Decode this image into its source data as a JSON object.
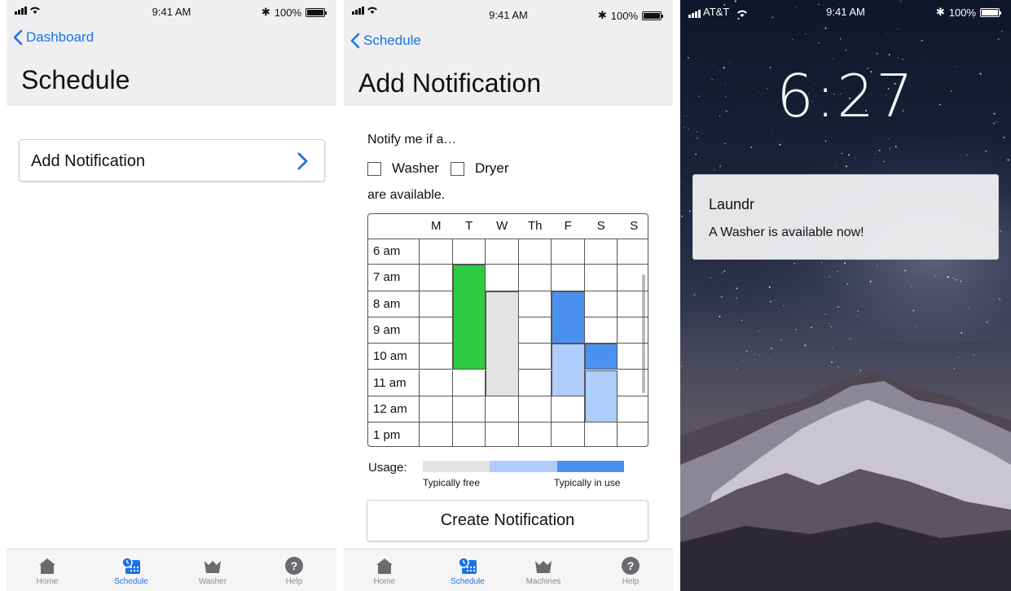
{
  "status": {
    "time": "9:41 AM",
    "battery": "100%",
    "carrier": "AT&T"
  },
  "tabs": {
    "home": "Home",
    "schedule": "Schedule",
    "washer": "Washer",
    "machines": "Machines",
    "help": "Help"
  },
  "screen1": {
    "back_label": "Dashboard",
    "title": "Schedule",
    "row_label": "Add Notification"
  },
  "screen2": {
    "back_label": "Schedule",
    "title": "Add Notification",
    "intro": "Notify me if a…",
    "options": [
      "Washer",
      "Dryer"
    ],
    "options_checked": [
      false,
      false
    ],
    "outro": "are available.",
    "days": [
      "M",
      "T",
      "W",
      "Th",
      "F",
      "S",
      "S"
    ],
    "times": [
      "6 am",
      "7 am",
      "8 am",
      "9 am",
      "10 am",
      "11 am",
      "12 am",
      "1 pm"
    ],
    "usage_label": "Usage:",
    "usage_low": "Typically free",
    "usage_high": "Typically in use",
    "create_label": "Create Notification",
    "blocks": [
      {
        "day": 1,
        "start": 1,
        "end": 5,
        "color": "#2ecc40"
      },
      {
        "day": 2,
        "start": 2,
        "end": 6,
        "color": "#e3e3e3"
      },
      {
        "day": 4,
        "start": 2,
        "end": 4,
        "color": "#4a90f0"
      },
      {
        "day": 4,
        "start": 4,
        "end": 6,
        "color": "#aecdfa"
      },
      {
        "day": 5,
        "start": 4,
        "end": 5,
        "color": "#4a90f0"
      },
      {
        "day": 5,
        "start": 5,
        "end": 7,
        "color": "#aecdfa"
      }
    ],
    "usage_colors": [
      "#e3e3e3",
      "#aecdfa",
      "#4a90f0"
    ]
  },
  "screen3": {
    "clock": "6:27",
    "notif_app": "Laundr",
    "notif_msg": "A Washer is available now!"
  },
  "colors": {
    "accent": "#1a73e8",
    "free": "#e3e3e3",
    "in_use": "#4a90f0",
    "selected": "#2ecc40"
  }
}
